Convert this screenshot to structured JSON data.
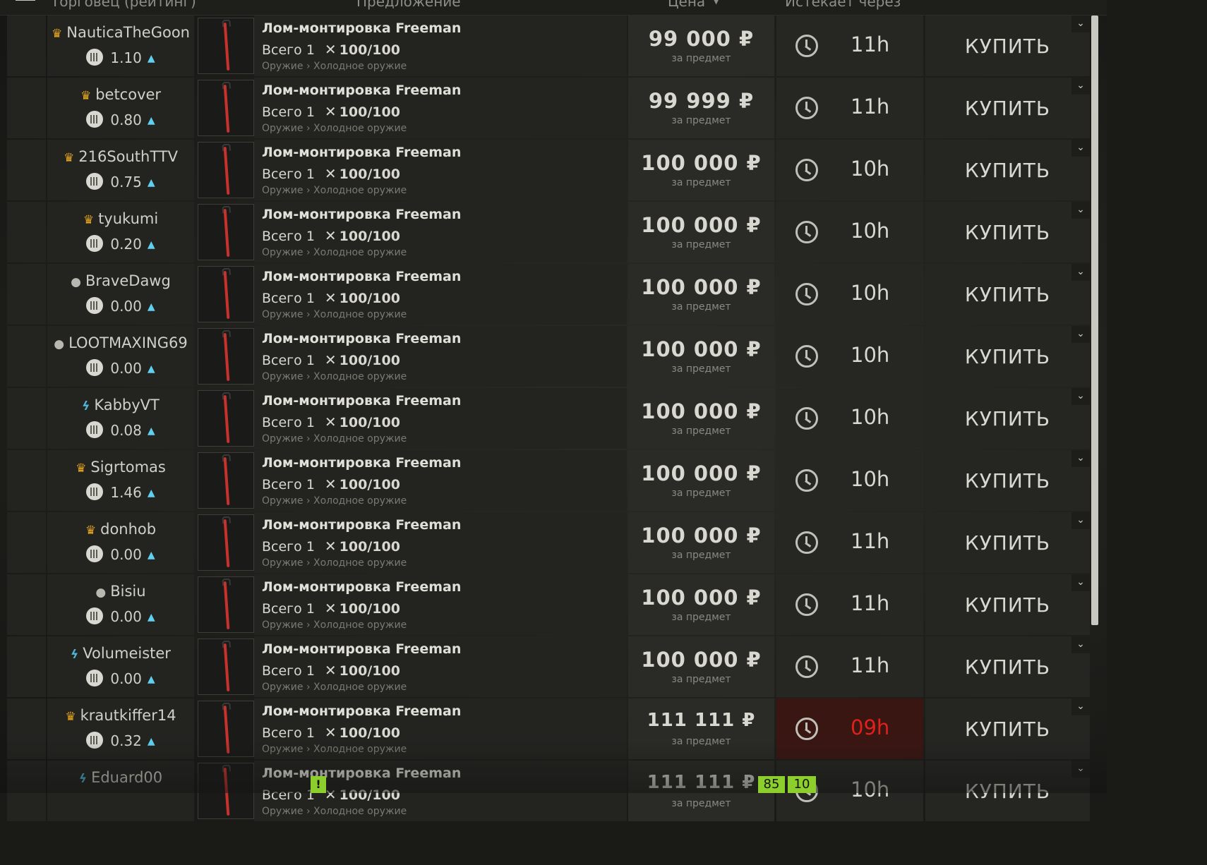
{
  "header": {
    "col_seller": "Торговец (рейтинг)",
    "col_offer": "Предложение",
    "col_price": "Цена",
    "col_expires": "Истекает через"
  },
  "common": {
    "item_name": "Лом-монтировка Freeman",
    "qty_label": "Всего 1",
    "durability": "100/100",
    "category": "Оружие › Холодное оружие",
    "price_unit": "за предмет",
    "buy_label": "КУПИТЬ"
  },
  "offers": [
    {
      "seller": "NauticaTheGoon",
      "badge": "crown",
      "rating": "1.10",
      "price": "99 000 ₽",
      "time": "11h",
      "expiring": false
    },
    {
      "seller": "betcover",
      "badge": "crown",
      "rating": "0.80",
      "price": "99 999 ₽",
      "time": "11h",
      "expiring": false
    },
    {
      "seller": "216SouthTTV",
      "badge": "crown",
      "rating": "0.75",
      "price": "100 000 ₽",
      "time": "10h",
      "expiring": false
    },
    {
      "seller": "tyukumi",
      "badge": "crown",
      "rating": "0.20",
      "price": "100 000 ₽",
      "time": "10h",
      "expiring": false
    },
    {
      "seller": "BraveDawg",
      "badge": "user",
      "rating": "0.00",
      "price": "100 000 ₽",
      "time": "10h",
      "expiring": false
    },
    {
      "seller": "LOOTMAXING69",
      "badge": "user",
      "rating": "0.00",
      "price": "100 000 ₽",
      "time": "10h",
      "expiring": false
    },
    {
      "seller": "KabbyVT",
      "badge": "bolt",
      "rating": "0.08",
      "price": "100 000 ₽",
      "time": "10h",
      "expiring": false
    },
    {
      "seller": "Sigrtomas",
      "badge": "crown",
      "rating": "1.46",
      "price": "100 000 ₽",
      "time": "10h",
      "expiring": false
    },
    {
      "seller": "donhob",
      "badge": "crown",
      "rating": "0.00",
      "price": "100 000 ₽",
      "time": "11h",
      "expiring": false
    },
    {
      "seller": "Bisiu",
      "badge": "user",
      "rating": "0.00",
      "price": "100 000 ₽",
      "time": "11h",
      "expiring": false
    },
    {
      "seller": "Volumeister",
      "badge": "bolt",
      "rating": "0.00",
      "price": "100 000 ₽",
      "time": "11h",
      "expiring": false
    },
    {
      "seller": "krautkiffer14",
      "badge": "crown",
      "rating": "0.32",
      "price": "111 111 ₽",
      "time": "09h",
      "expiring": true
    },
    {
      "seller": "Eduard00",
      "badge": "bolt",
      "rating": "",
      "price": "111 111 ₽",
      "time": "10h",
      "expiring": false
    }
  ],
  "hud": {
    "warn": "!",
    "a": "85",
    "b": "10"
  },
  "colors": {
    "crown": "#e6a619",
    "bolt": "#4fb6d8",
    "expiring_text": "#e0201a",
    "hud_green": "#8ccf2c"
  }
}
